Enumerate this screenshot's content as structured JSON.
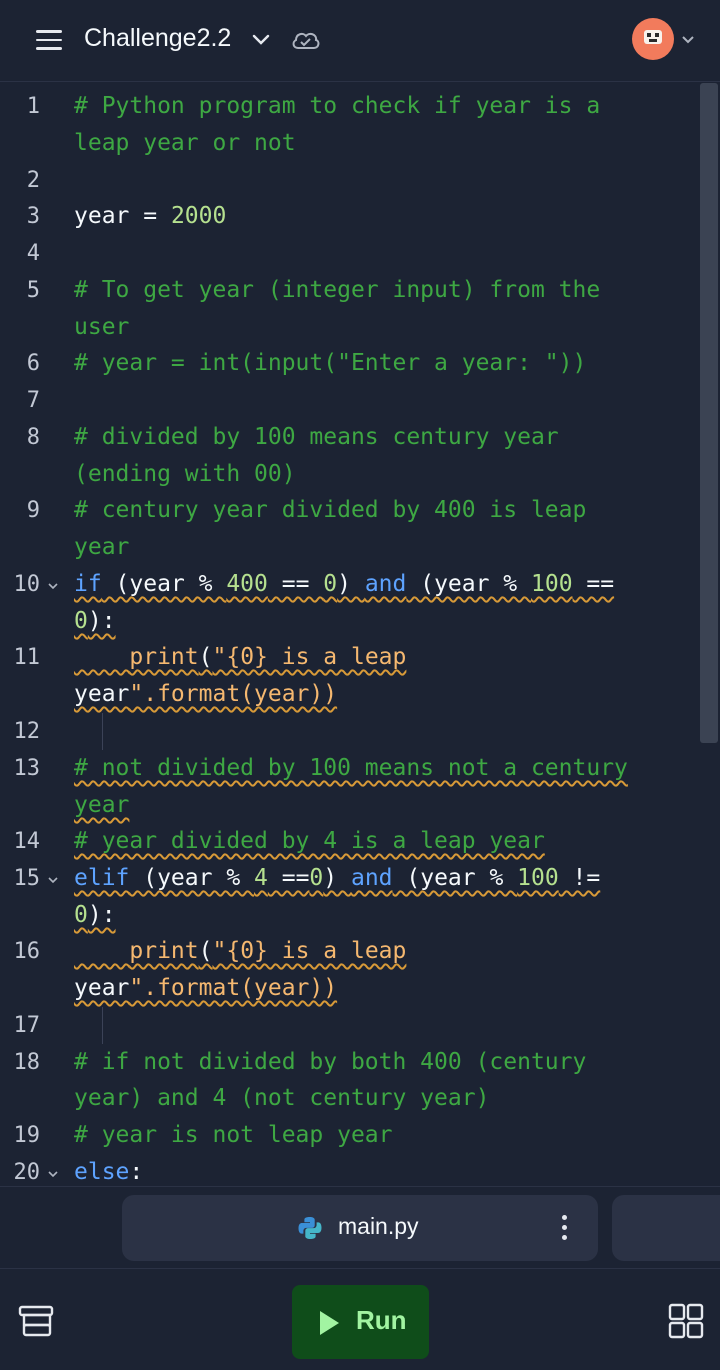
{
  "header": {
    "title": "Challenge2.2",
    "icons": [
      "menu-icon",
      "chevron-down-icon",
      "cloud-check-icon",
      "avatar",
      "chevron-down-icon"
    ]
  },
  "editor": {
    "lines": [
      {
        "n": "1",
        "wrap": [
          "# Python program to check if year is a",
          "leap year or not"
        ]
      },
      {
        "n": "2",
        "wrap": [
          ""
        ]
      },
      {
        "n": "3",
        "wrap": [
          "year = 2000"
        ]
      },
      {
        "n": "4",
        "wrap": [
          ""
        ]
      },
      {
        "n": "5",
        "wrap": [
          "# To get year (integer input) from the",
          "user"
        ]
      },
      {
        "n": "6",
        "wrap": [
          "# year = int(input(\"Enter a year: \"))"
        ]
      },
      {
        "n": "7",
        "wrap": [
          ""
        ]
      },
      {
        "n": "8",
        "wrap": [
          "# divided by 100 means century year",
          "(ending with 00)"
        ]
      },
      {
        "n": "9",
        "wrap": [
          "# century year divided by 400 is leap",
          "year"
        ]
      },
      {
        "n": "10",
        "wrap": [
          "if (year % 400 == 0) and (year % 100 ==",
          "0):"
        ]
      },
      {
        "n": "11",
        "wrap": [
          "    print(\"{0} is a leap",
          "year\".format(year))"
        ]
      },
      {
        "n": "12",
        "wrap": [
          ""
        ]
      },
      {
        "n": "13",
        "wrap": [
          "# not divided by 100 means not a century",
          "year"
        ]
      },
      {
        "n": "14",
        "wrap": [
          "# year divided by 4 is a leap year"
        ]
      },
      {
        "n": "15",
        "wrap": [
          "elif (year % 4 ==0) and (year % 100 !=",
          "0):"
        ]
      },
      {
        "n": "16",
        "wrap": [
          "    print(\"{0} is a leap",
          "year\".format(year))"
        ]
      },
      {
        "n": "17",
        "wrap": [
          ""
        ]
      },
      {
        "n": "18",
        "wrap": [
          "# if not divided by both 400 (century",
          "year) and 4 (not century year)"
        ]
      },
      {
        "n": "19",
        "wrap": [
          "# year is not leap year"
        ]
      },
      {
        "n": "20",
        "wrap": [
          "else:"
        ]
      }
    ],
    "colors": {
      "comment": "#3ea843",
      "keyword": "#5ea3ff",
      "number": "#b5e08f",
      "string": "#f5b870"
    }
  },
  "file_tab": {
    "label": "main.py",
    "icon": "python-icon",
    "menu_icon": "kebab-icon"
  },
  "bottom": {
    "run_label": "Run",
    "left_icon": "stack-icon",
    "right_icon": "grid-icon"
  }
}
